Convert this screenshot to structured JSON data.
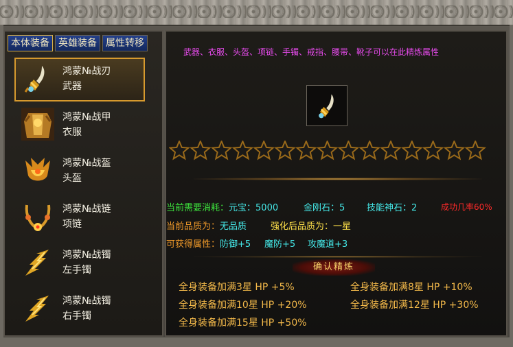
{
  "tabs": [
    "本体装备",
    "英雄装备",
    "属性转移"
  ],
  "items": [
    {
      "name": "鸿蒙№战刃",
      "type": "武器",
      "icon": "blade-icon"
    },
    {
      "name": "鸿蒙№战甲",
      "type": "衣服",
      "icon": "armor-icon"
    },
    {
      "name": "鸿蒙№战盔",
      "type": "头盔",
      "icon": "helmet-icon"
    },
    {
      "name": "鸿蒙№战链",
      "type": "项链",
      "icon": "necklace-icon"
    },
    {
      "name": "鸿蒙№战镯",
      "type": "左手镯",
      "icon": "bracelet-icon"
    },
    {
      "name": "鸿蒙№战镯",
      "type": "右手镯",
      "icon": "bracelet-icon"
    }
  ],
  "instruction": "武器、衣服、头盔、项链、手镯、戒指、腰带、靴子可以在此精炼属性",
  "preview_icon": "blade-icon",
  "star_count": 15,
  "stars_filled": 0,
  "cost": {
    "label": "当前需要消耗：",
    "yuanbao_label": "元宝：",
    "yuanbao": "5000",
    "diamond_label": "金刚石：",
    "diamond": "5",
    "skill_label": "技能神石：",
    "skill": "2",
    "success": "成功几率60%"
  },
  "quality": {
    "current_label": "当前品质为：",
    "current_value": "无品质",
    "after_label": "强化后品质为：",
    "after_value": "一星"
  },
  "attrs": {
    "label": "可获得属性：",
    "def": "防御+5",
    "mdef": "魔防+5",
    "matk": "攻魔道+3"
  },
  "confirm_label": "确认精炼",
  "bonuses": [
    "全身装备加满3星  HP +5%",
    "全身装备加满8星  HP +10%",
    "全身装备加满10星 HP +20%",
    "全身装备加满12星 HP +30%",
    "全身装备加满15星 HP +50%"
  ],
  "colors": {
    "accent_gold": "#d79a2e",
    "green": "#3ce03c",
    "cyan": "#45e8e8",
    "orange": "#f09a2a",
    "red": "#ff2a2a",
    "magenta": "#e34ae8"
  }
}
